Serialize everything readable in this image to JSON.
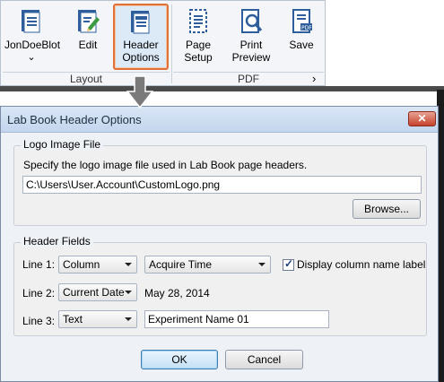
{
  "ribbon": {
    "groups": [
      {
        "label": "Layout"
      },
      {
        "label": "PDF"
      }
    ],
    "buttons": [
      {
        "label": "JonDoeBlot",
        "dropdown": "⌄"
      },
      {
        "label": "Edit"
      },
      {
        "label": "Header\nOptions"
      },
      {
        "label": "Page\nSetup"
      },
      {
        "label": "Print\nPreview"
      },
      {
        "label": "Save"
      }
    ],
    "expand_glyph": "›"
  },
  "dialog": {
    "title": "Lab Book Header Options",
    "close_glyph": "✕",
    "logo_group": {
      "title": "Logo Image File",
      "description": "Specify the logo image file used in Lab Book page headers.",
      "path_value": "C:\\Users\\User.Account\\CustomLogo.png",
      "browse_label": "Browse..."
    },
    "header_fields": {
      "title": "Header Fields",
      "line1": {
        "label": "Line 1:",
        "type": "Column",
        "field": "Acquire Time",
        "checkbox_label": "Display column name label",
        "checked": true
      },
      "line2": {
        "label": "Line 2:",
        "type": "Current Date",
        "value": "May 28, 2014"
      },
      "line3": {
        "label": "Line 3:",
        "type": "Text",
        "value": "Experiment Name 01"
      }
    },
    "ok_label": "OK",
    "cancel_label": "Cancel"
  },
  "colors": {
    "selected_border": "#e0703a",
    "dialog_bg": "#eef2f7",
    "close_red": "#c6422c"
  }
}
